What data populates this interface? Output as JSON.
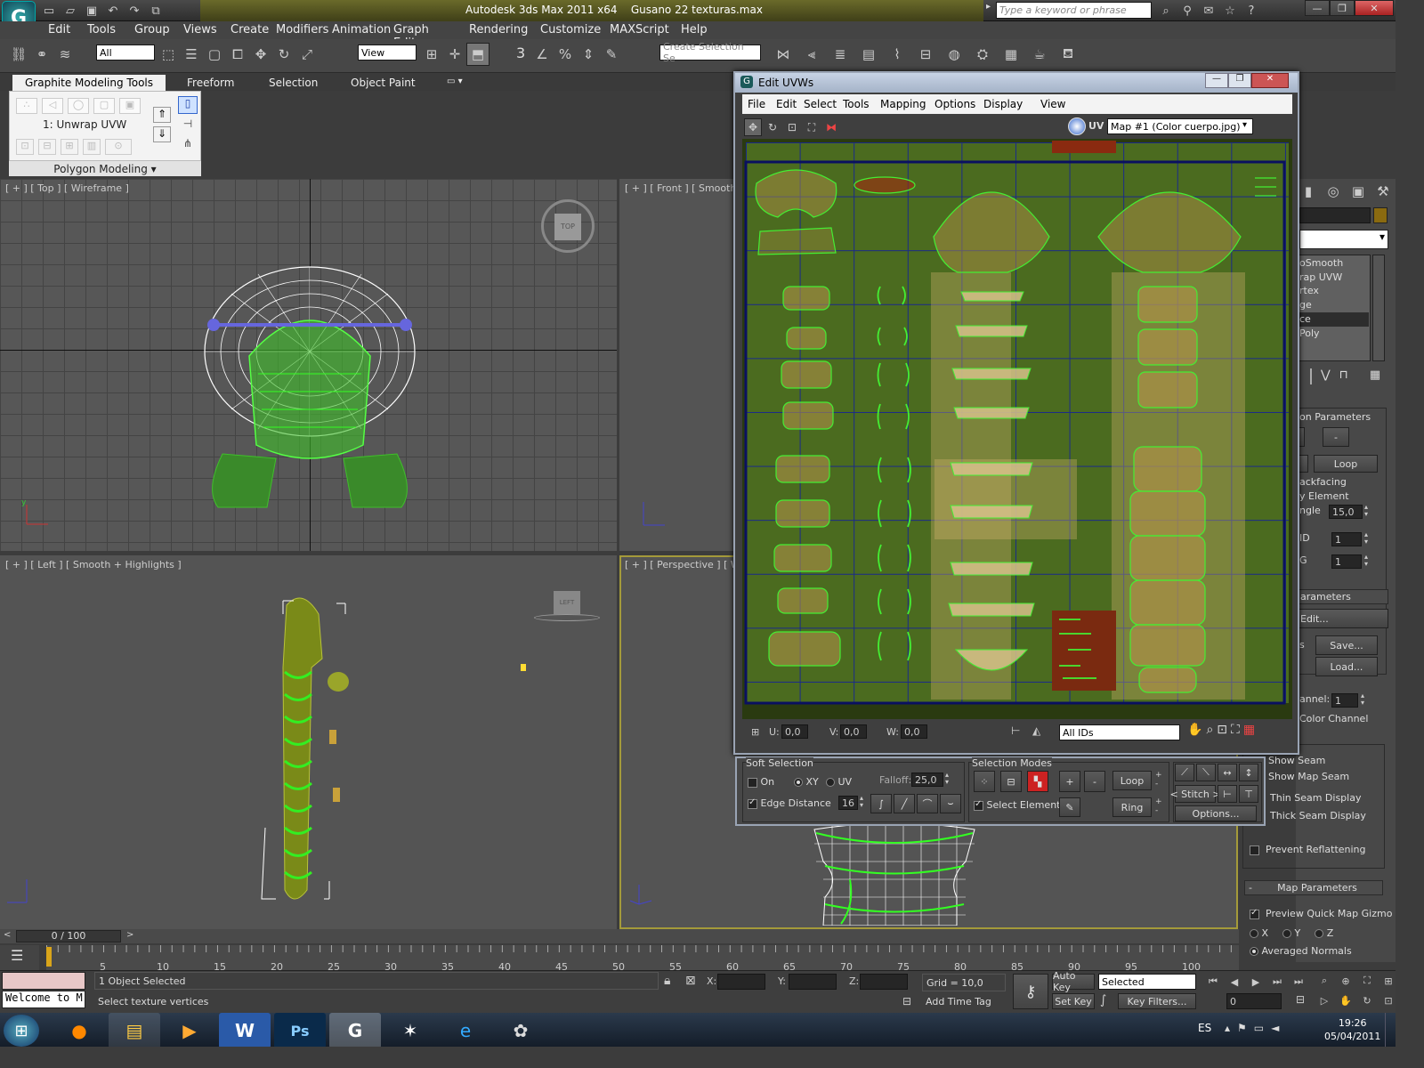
{
  "app": {
    "title": "Autodesk 3ds Max  2011 x64",
    "file": "Gusano 22 texturas.max",
    "search_placeholder": "Type a keyword or phrase",
    "logo": "3ds-max-logo"
  },
  "menu": [
    "Edit",
    "Tools",
    "Group",
    "Views",
    "Create",
    "Modifiers",
    "Animation",
    "Graph Editors",
    "Rendering",
    "Customize",
    "MAXScript",
    "Help"
  ],
  "toolbar": {
    "filter": "All",
    "coord": "View",
    "selection_set": "Create Selection Se",
    "snap_label": "3"
  },
  "ribbon": {
    "tabs": [
      "Graphite Modeling Tools",
      "Freeform",
      "Selection",
      "Object Paint"
    ],
    "modifier": "1: Unwrap UVW",
    "panel": "Polygon Modeling"
  },
  "viewports": {
    "top": "[ + ] [ Top ] [ Wireframe ]",
    "front": "[ + ] [ Front ] [ Smooth + H",
    "left": "[ + ] [ Left ] [ Smooth + Highlights ]",
    "persp": "[ + ] [ Perspective ] [ Wire",
    "cube_top": "TOP",
    "cube_left": "LEFT"
  },
  "uvw": {
    "title": "Edit UVWs",
    "menu": [
      "File",
      "Edit",
      "Select",
      "Tools",
      "Mapping",
      "Options",
      "Display",
      "View"
    ],
    "map": "Map #1 (Color cuerpo.jpg)",
    "uv_label": "UV",
    "u_label": "U:",
    "u": "0,0",
    "v_label": "V:",
    "v": "0,0",
    "w_label": "W:",
    "w": "0,0",
    "ids": "All IDs"
  },
  "soft": {
    "title": "Soft Selection",
    "on": "On",
    "xy": "XY",
    "uv": "UV",
    "falloff_label": "Falloff:",
    "falloff": "25,0",
    "edge_distance": "Edge Distance",
    "edge_value": "16"
  },
  "modes": {
    "title": "Selection Modes",
    "select_element": "Select Element",
    "loop": "Loop",
    "ring": "Ring",
    "stitch": "Stitch",
    "options": "Options...",
    "plus": "+",
    "minus": "-"
  },
  "cmd": {
    "stack": [
      "oSmooth",
      "rap UVW",
      "rtex",
      "ge",
      "ce",
      "Poly"
    ],
    "sel_params": "on Parameters",
    "loop": "Loop",
    "minus": "-",
    "backfacing": "ackfacing",
    "by_element": "y Element",
    "angle_label": "ngle",
    "angle": "15,0",
    "id_label": "ID",
    "id_value": "1",
    "g_label": "G",
    "g_value": "1",
    "params": "arameters",
    "edit": "Edit...",
    "save": "Save...",
    "load": "Load...",
    "s_label": "s",
    "channel_label": "annel:",
    "channel": "1",
    "color_channel": "Color Channel",
    "show_seam": "Show Seam",
    "show_map_seam": "Show Map Seam",
    "thin_seam": "Thin Seam Display",
    "thick_seam": "Thick Seam Display",
    "prevent": "Prevent Reflattening",
    "map_params": "Map Parameters",
    "preview": "Preview Quick Map Gizmo",
    "x": "X",
    "y": "Y",
    "z": "Z",
    "averaged": "Averaged Normals"
  },
  "timeline": {
    "frame": "0 / 100",
    "ticks": [
      "5",
      "10",
      "15",
      "20",
      "25",
      "30",
      "35",
      "40",
      "45",
      "50",
      "55",
      "60",
      "65",
      "70",
      "75",
      "80",
      "85",
      "90",
      "95",
      "100"
    ]
  },
  "status": {
    "welcome": "Welcome to M",
    "selected": "1 Object Selected",
    "prompt": "Select texture vertices",
    "x_label": "X:",
    "y_label": "Y:",
    "z_label": "Z:",
    "grid": "Grid = 10,0",
    "add_time_tag": "Add Time Tag",
    "auto_key": "Auto Key",
    "set_key": "Set Key",
    "key_mode": "Selected",
    "key_filters": "Key Filters...",
    "frame": "0"
  },
  "taskbar": {
    "lang": "ES",
    "time": "19:26",
    "date": "05/04/2011"
  }
}
